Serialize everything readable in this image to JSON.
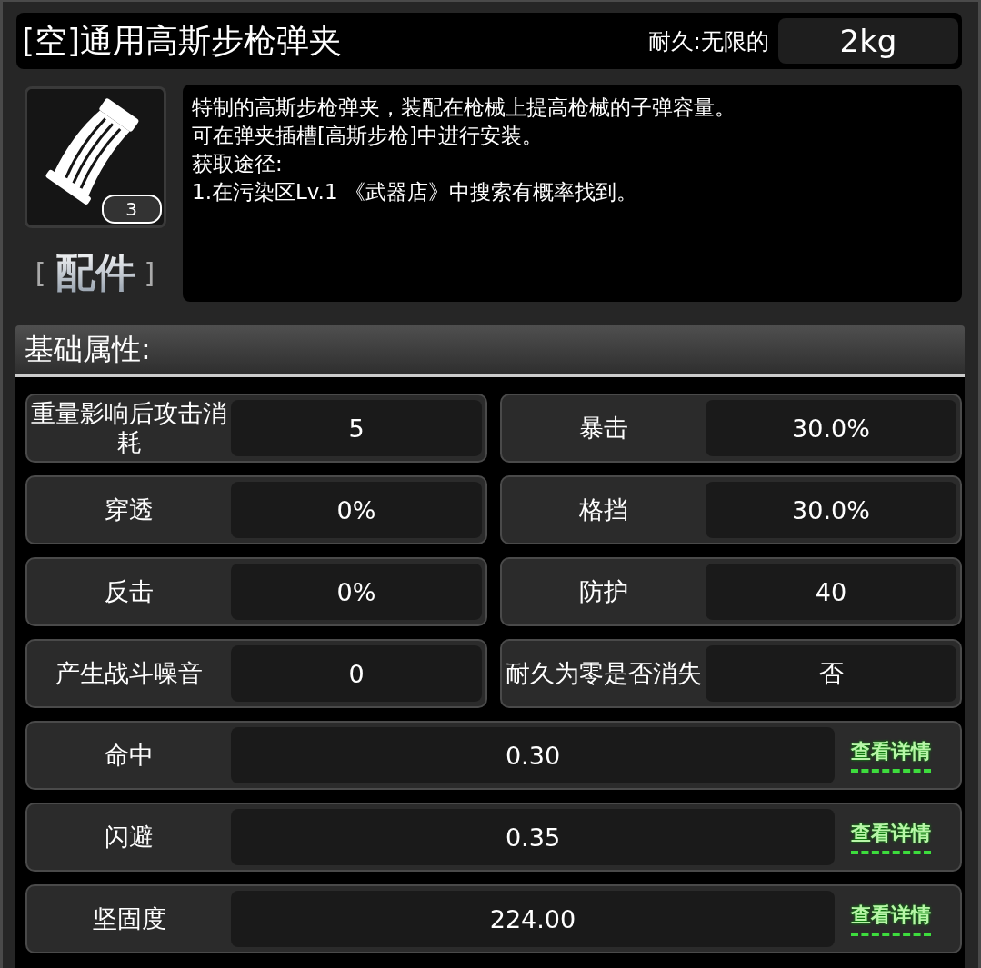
{
  "title": "[空]通用高斯步枪弹夹",
  "durability": "耐久:无限的",
  "weight": "2kg",
  "item": {
    "count": "3",
    "category_open": "[",
    "category": "配件",
    "category_close": "]"
  },
  "description": [
    "特制的高斯步枪弹夹，装配在枪械上提高枪械的子弹容量。",
    "可在弹夹插槽[高斯步枪]中进行安装。",
    "获取途径:",
    "1.在污染区Lv.1 《武器店》中搜索有概率找到。"
  ],
  "section_title": "基础属性:",
  "stats": [
    {
      "kind": "pair",
      "label": "重量影响后攻击消耗",
      "value": "5"
    },
    {
      "kind": "pair",
      "label": "暴击",
      "value": "30.0%"
    },
    {
      "kind": "pair",
      "label": "穿透",
      "value": "0%"
    },
    {
      "kind": "pair",
      "label": "格挡",
      "value": "30.0%"
    },
    {
      "kind": "pair",
      "label": "反击",
      "value": "0%"
    },
    {
      "kind": "pair",
      "label": "防护",
      "value": "40"
    },
    {
      "kind": "pair",
      "label": "产生战斗噪音",
      "value": "0"
    },
    {
      "kind": "pair",
      "label": "耐久为零是否消失",
      "value": "否"
    },
    {
      "kind": "detail",
      "label": "命中",
      "value": "0.30",
      "link": "查看详情"
    },
    {
      "kind": "detail",
      "label": "闪避",
      "value": "0.35",
      "link": "查看详情"
    },
    {
      "kind": "detail",
      "label": "坚固度",
      "value": "224.00",
      "link": "查看详情"
    }
  ]
}
